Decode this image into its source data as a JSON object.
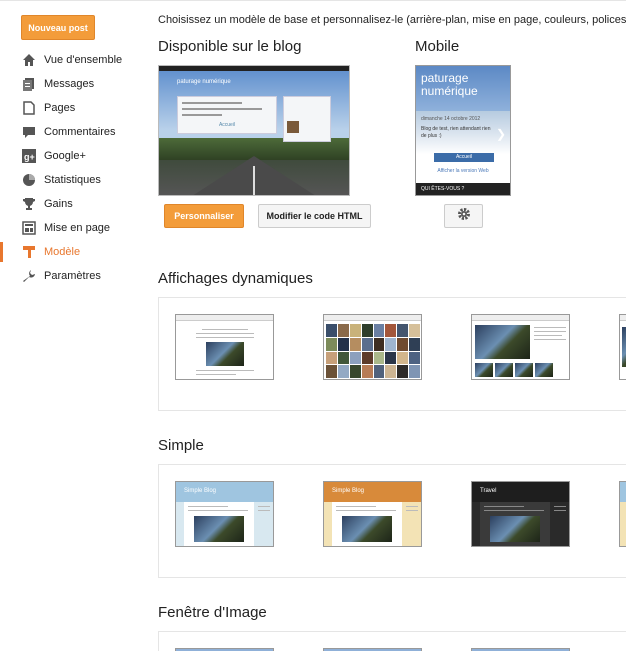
{
  "sidebar": {
    "new_post": "Nouveau post",
    "items": [
      {
        "label": "Vue d'ensemble",
        "icon": "home-icon"
      },
      {
        "label": "Messages",
        "icon": "messages-icon"
      },
      {
        "label": "Pages",
        "icon": "pages-icon"
      },
      {
        "label": "Commentaires",
        "icon": "comment-icon"
      },
      {
        "label": "Google+",
        "icon": "google-plus-icon"
      },
      {
        "label": "Statistiques",
        "icon": "stats-pie-icon"
      },
      {
        "label": "Gains",
        "icon": "trophy-icon"
      },
      {
        "label": "Mise en page",
        "icon": "layout-icon"
      },
      {
        "label": "Modèle",
        "icon": "template-icon",
        "active": true
      },
      {
        "label": "Paramètres",
        "icon": "wrench-icon"
      }
    ],
    "active_color": "#e8772e"
  },
  "main": {
    "intro": "Choisissez un modèle de base et personnalisez-le (arrière-plan, mise en page, couleurs, polices, etc.",
    "blog_heading": "Disponible sur le blog",
    "mobile_heading": "Mobile",
    "blog_preview": {
      "title": "paturage numérique",
      "accueil": "Accueil"
    },
    "mobile_preview": {
      "title": "paturage numérique",
      "date": "dimanche 14 octobre 2012",
      "post_text": "Blog de test, rien attendant rien de plus :)",
      "accueil": "Accueil",
      "web_link": "Afficher la version Web",
      "footer": "QUI ÊTES-VOUS ?"
    },
    "customize_button": "Personnaliser",
    "edit_html_button": "Modifier le code HTML",
    "accent_color": "#f39c3a",
    "sections": [
      {
        "title": "Affichages dynamiques"
      },
      {
        "title": "Simple",
        "template_titles": [
          "Simple Blog",
          "Simple Blog",
          "Travel"
        ]
      },
      {
        "title": "Fenêtre d'Image"
      }
    ]
  }
}
